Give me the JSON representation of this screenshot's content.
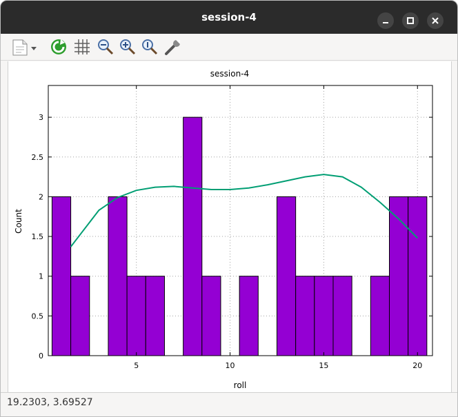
{
  "window": {
    "title": "session-4"
  },
  "toolbar": {
    "icons": [
      "export-icon",
      "refresh-icon",
      "grid-icon",
      "zoom-out-icon",
      "zoom-in-icon",
      "zoom-reset-icon",
      "settings-icon"
    ]
  },
  "status": {
    "coords": "19.2303,  3.69527"
  },
  "colors": {
    "bar": "#9400d3",
    "curve": "#009e73",
    "titlebar": "#2b2b2b"
  },
  "chart_data": {
    "type": "bar",
    "title": "session-4",
    "xlabel": "roll",
    "ylabel": "Count",
    "xlim": [
      0.3,
      20.8
    ],
    "ylim": [
      0,
      3.4
    ],
    "x": [
      1,
      2,
      3,
      4,
      5,
      6,
      7,
      8,
      9,
      10,
      11,
      12,
      13,
      14,
      15,
      16,
      17,
      18,
      19,
      20
    ],
    "values": [
      2,
      1,
      0,
      2,
      1,
      1,
      0,
      3,
      1,
      0,
      1,
      0,
      2,
      1,
      1,
      1,
      0,
      1,
      2,
      2
    ],
    "xticks": [
      5,
      10,
      15,
      20
    ],
    "yticks": [
      0,
      0.5,
      1,
      1.5,
      2,
      2.5,
      3
    ],
    "grid": true,
    "curve": {
      "type": "line",
      "x": [
        1.5,
        3,
        4,
        5,
        6,
        7,
        8,
        9,
        10,
        11,
        12,
        13,
        14,
        15,
        16,
        17,
        18,
        19,
        20
      ],
      "y": [
        1.37,
        1.83,
        1.99,
        2.08,
        2.12,
        2.13,
        2.11,
        2.09,
        2.09,
        2.11,
        2.15,
        2.2,
        2.25,
        2.28,
        2.25,
        2.12,
        1.93,
        1.72,
        1.48
      ]
    }
  }
}
